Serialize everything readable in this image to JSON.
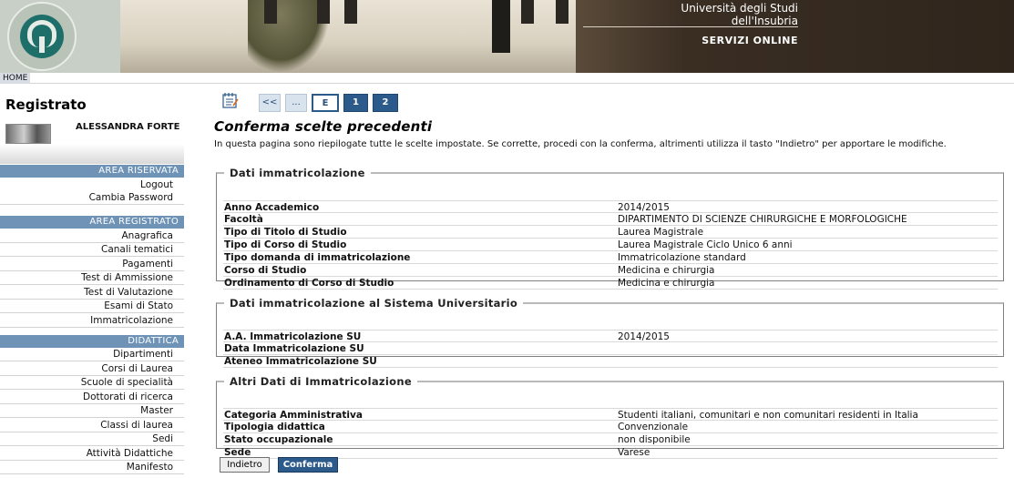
{
  "header": {
    "university_line1": "Università degli Studi",
    "university_line2": "dell'Insubria",
    "service": "SERVIZI ONLINE",
    "home": "HOME"
  },
  "sidebar": {
    "title": "Registrato",
    "user_name": "ALESSANDRA FORTE",
    "sections": [
      {
        "heading": "AREA RISERVATA",
        "items": [
          "Logout",
          "Cambia Password"
        ]
      },
      {
        "heading": "AREA REGISTRATO",
        "items": [
          "Anagrafica",
          "Canali tematici",
          "Pagamenti",
          "Test di Ammissione",
          "Test di Valutazione",
          "Esami di Stato",
          "Immatricolazione"
        ]
      },
      {
        "heading": "DIDATTICA",
        "items": [
          "Dipartimenti",
          "Corsi di Laurea",
          "Scuole di specialità",
          "Dottorati di ricerca",
          "Master",
          "Classi di laurea",
          "Sedi",
          "Attività Didattiche",
          "Manifesto"
        ]
      }
    ]
  },
  "pager": {
    "first": "<<",
    "ellipsis": "...",
    "current": "E",
    "step1": "1",
    "step2": "2"
  },
  "main": {
    "title": "Conferma scelte precedenti",
    "intro": "In questa pagina sono riepilogate tutte le scelte impostate. Se corrette, procedi con la conferma, altrimenti utilizza il tasto \"Indietro\" per apportare le modifiche."
  },
  "sections": [
    {
      "legend": "Dati immatricolazione",
      "rows": [
        {
          "key": "Anno Accademico",
          "value": "2014/2015"
        },
        {
          "key": "Facoltà",
          "value": "DIPARTIMENTO DI SCIENZE CHIRURGICHE E MORFOLOGICHE"
        },
        {
          "key": "Tipo di Titolo di Studio",
          "value": "Laurea Magistrale"
        },
        {
          "key": "Tipo di Corso di Studio",
          "value": "Laurea Magistrale Ciclo Unico 6 anni"
        },
        {
          "key": "Tipo domanda di immatricolazione",
          "value": "Immatricolazione standard"
        },
        {
          "key": "Corso di Studio",
          "value": "Medicina e chirurgia"
        },
        {
          "key": "Ordinamento di Corso di Studio",
          "value": "Medicina e chirurgia"
        }
      ]
    },
    {
      "legend": "Dati immatricolazione al Sistema Universitario",
      "rows": [
        {
          "key": "A.A. Immatricolazione SU",
          "value": "2014/2015"
        },
        {
          "key": "Data Immatricolazione SU",
          "value": ""
        },
        {
          "key": "Ateneo Immatricolazione SU",
          "value": ""
        }
      ]
    },
    {
      "legend": "Altri Dati di Immatricolazione",
      "rows": [
        {
          "key": "Categoria Amministrativa",
          "value": "Studenti italiani, comunitari e non comunitari residenti in Italia"
        },
        {
          "key": "Tipologia didattica",
          "value": "Convenzionale"
        },
        {
          "key": "Stato occupazionale",
          "value": "non disponibile"
        },
        {
          "key": "Sede",
          "value": "Varese"
        }
      ]
    }
  ],
  "buttons": {
    "back": "Indietro",
    "confirm": "Conferma"
  },
  "colors": {
    "accent": "#2c5a8a",
    "sidebar_heading": "#6e93b6"
  }
}
